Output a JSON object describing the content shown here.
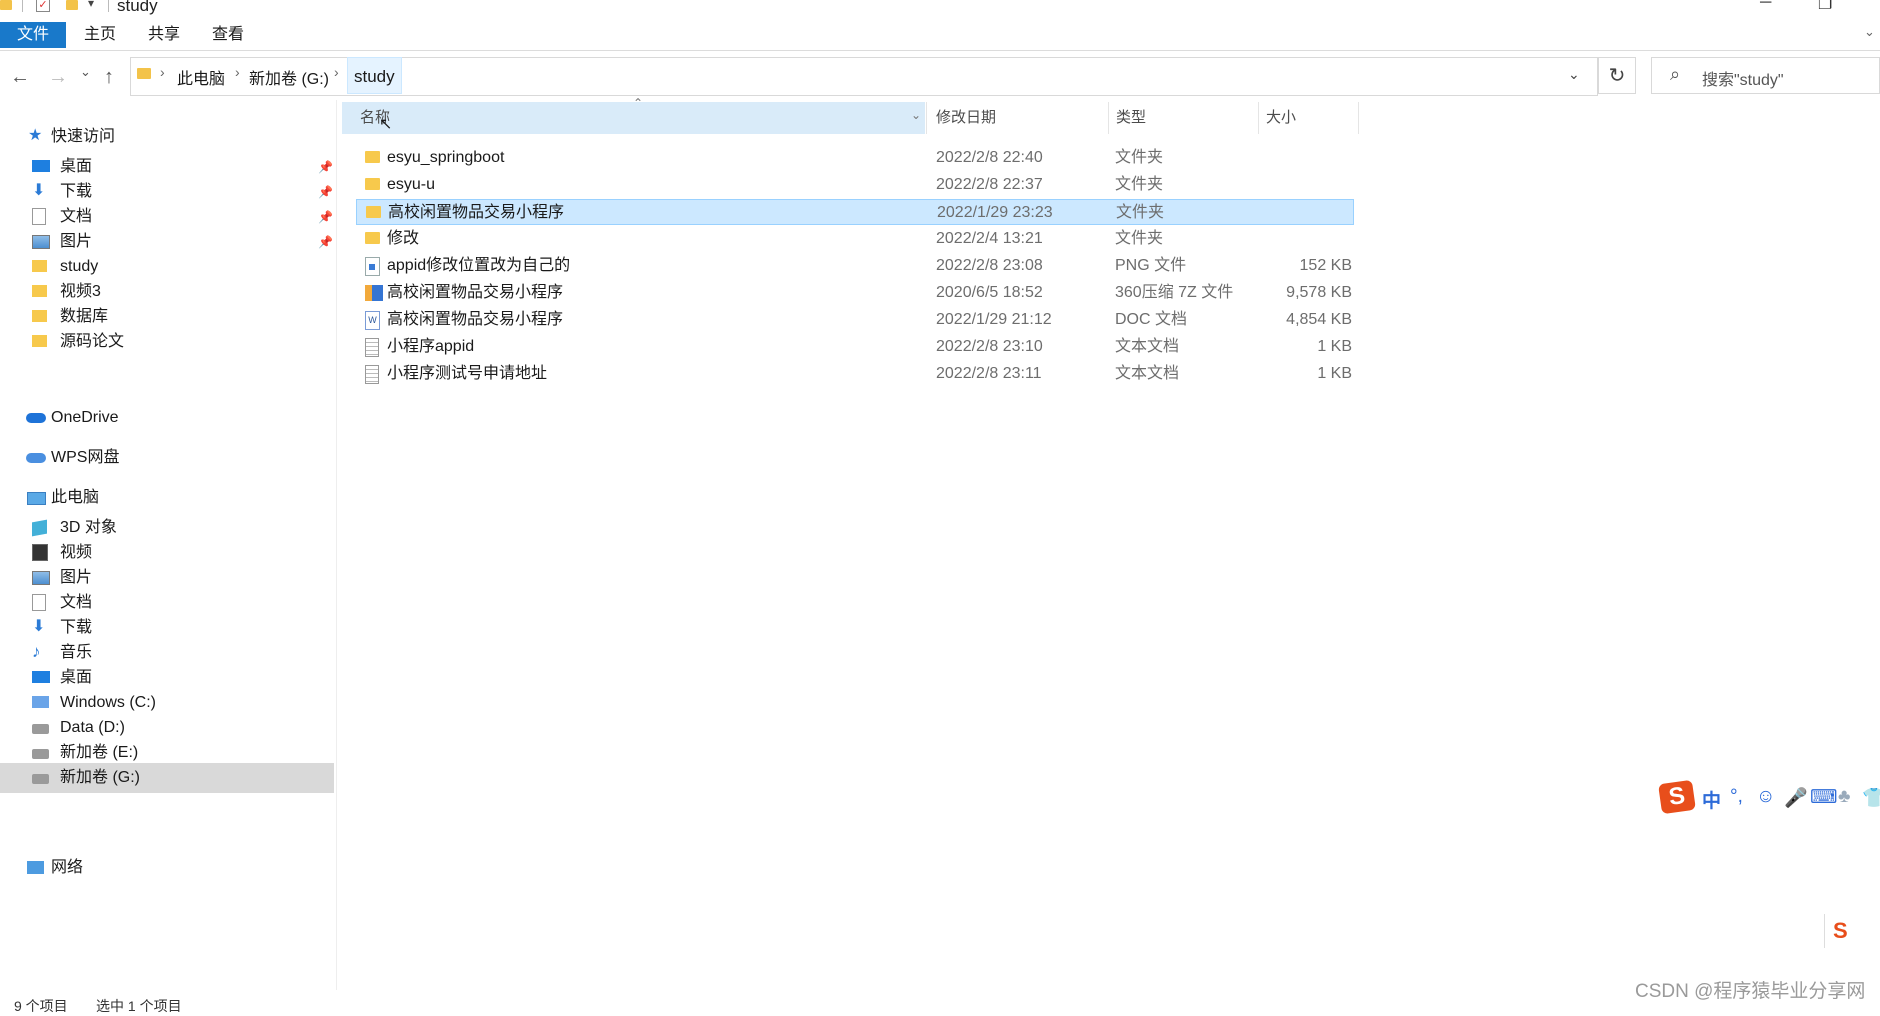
{
  "window": {
    "title": "study"
  },
  "ribbon": {
    "tabs": [
      "文件",
      "主页",
      "共享",
      "查看"
    ]
  },
  "address": {
    "crumbs": [
      "此电脑",
      "新加卷 (G:)"
    ],
    "current": "study",
    "search_placeholder": "搜索\"study\""
  },
  "sidebar": {
    "quick_access": "快速访问",
    "quick_items": [
      {
        "label": "桌面",
        "icon": "desktop-icon",
        "pinned": true
      },
      {
        "label": "下载",
        "icon": "download-icon",
        "pinned": true
      },
      {
        "label": "文档",
        "icon": "document-icon",
        "pinned": true
      },
      {
        "label": "图片",
        "icon": "pictures-icon",
        "pinned": true
      },
      {
        "label": "study",
        "icon": "folder-icon",
        "pinned": false
      },
      {
        "label": "视频3",
        "icon": "folder-icon",
        "pinned": false
      },
      {
        "label": "数据库",
        "icon": "folder-icon",
        "pinned": false
      },
      {
        "label": "源码论文",
        "icon": "folder-icon",
        "pinned": false
      }
    ],
    "onedrive": "OneDrive",
    "wps": "WPS网盘",
    "this_pc": "此电脑",
    "pc_items": [
      {
        "label": "3D 对象",
        "icon": "3d-objects-icon"
      },
      {
        "label": "视频",
        "icon": "videos-icon"
      },
      {
        "label": "图片",
        "icon": "pictures-icon"
      },
      {
        "label": "文档",
        "icon": "document-icon"
      },
      {
        "label": "下载",
        "icon": "download-icon"
      },
      {
        "label": "音乐",
        "icon": "music-icon"
      },
      {
        "label": "桌面",
        "icon": "desktop-icon"
      },
      {
        "label": "Windows (C:)",
        "icon": "windows-drive-icon"
      },
      {
        "label": "Data (D:)",
        "icon": "drive-icon"
      },
      {
        "label": "新加卷 (E:)",
        "icon": "drive-icon"
      },
      {
        "label": "新加卷 (G:)",
        "icon": "drive-icon",
        "selected": true
      }
    ],
    "network": "网络"
  },
  "columns": {
    "name": "名称",
    "date": "修改日期",
    "type": "类型",
    "size": "大小"
  },
  "files": [
    {
      "name": "esyu_springboot",
      "date": "2022/2/8 22:40",
      "type": "文件夹",
      "size": "",
      "icon": "folder-icon"
    },
    {
      "name": "esyu-u",
      "date": "2022/2/8 22:37",
      "type": "文件夹",
      "size": "",
      "icon": "folder-icon"
    },
    {
      "name": "高校闲置物品交易小程序",
      "date": "2022/1/29 23:23",
      "type": "文件夹",
      "size": "",
      "icon": "folder-icon",
      "selected": true
    },
    {
      "name": "修改",
      "date": "2022/2/4 13:21",
      "type": "文件夹",
      "size": "",
      "icon": "folder-icon"
    },
    {
      "name": "appid修改位置改为自己的",
      "date": "2022/2/8 23:08",
      "type": "PNG 文件",
      "size": "152 KB",
      "icon": "image-file-icon"
    },
    {
      "name": "高校闲置物品交易小程序",
      "date": "2020/6/5 18:52",
      "type": "360压缩 7Z 文件",
      "size": "9,578 KB",
      "icon": "archive-file-icon"
    },
    {
      "name": "高校闲置物品交易小程序",
      "date": "2022/1/29 21:12",
      "type": "DOC 文档",
      "size": "4,854 KB",
      "icon": "word-file-icon"
    },
    {
      "name": "小程序appid",
      "date": "2022/2/8 23:10",
      "type": "文本文档",
      "size": "1 KB",
      "icon": "text-file-icon"
    },
    {
      "name": "小程序测试号申请地址",
      "date": "2022/2/8 23:11",
      "type": "文本文档",
      "size": "1 KB",
      "icon": "text-file-icon"
    }
  ],
  "status": {
    "count": "9 个项目",
    "selected": "选中 1 个项目"
  },
  "ime": {
    "lang": "中"
  },
  "watermark": "CSDN @程序猿毕业分享网"
}
